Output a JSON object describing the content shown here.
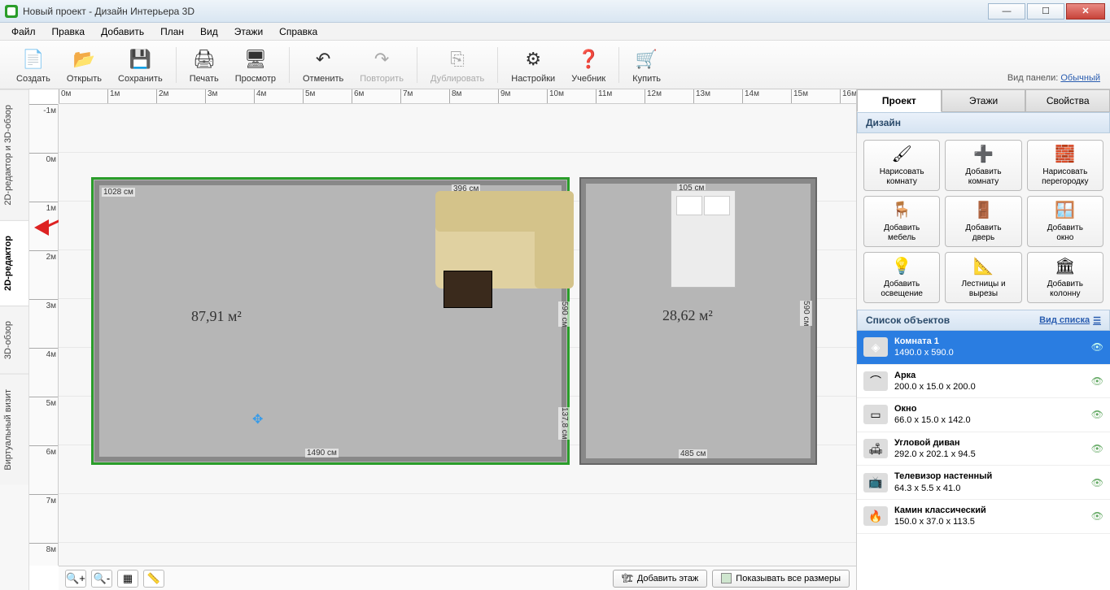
{
  "title": "Новый проект - Дизайн Интерьера 3D",
  "menu": [
    "Файл",
    "Правка",
    "Добавить",
    "План",
    "Вид",
    "Этажи",
    "Справка"
  ],
  "toolbar": [
    {
      "label": "Создать",
      "icon": "📄"
    },
    {
      "label": "Открыть",
      "icon": "📂"
    },
    {
      "label": "Сохранить",
      "icon": "💾"
    },
    {
      "sep": true
    },
    {
      "label": "Печать",
      "icon": "🖨"
    },
    {
      "label": "Просмотр",
      "icon": "🖥"
    },
    {
      "sep": true
    },
    {
      "label": "Отменить",
      "icon": "↶"
    },
    {
      "label": "Повторить",
      "icon": "↷",
      "disabled": true
    },
    {
      "sep": true
    },
    {
      "label": "Дублировать",
      "icon": "⎘",
      "disabled": true
    },
    {
      "sep": true
    },
    {
      "label": "Настройки",
      "icon": "⚙"
    },
    {
      "label": "Учебник",
      "icon": "❓"
    },
    {
      "sep": true
    },
    {
      "label": "Купить",
      "icon": "🛒"
    }
  ],
  "panel_label": "Вид панели:",
  "panel_mode": "Обычный",
  "vtabs": [
    "2D-редактор и 3D-обзор",
    "2D-редактор",
    "3D-обзор",
    "Виртуальный визит"
  ],
  "ruler_h": [
    "0м",
    "1м",
    "2м",
    "3м",
    "4м",
    "5м",
    "6м",
    "7м",
    "8м",
    "9м",
    "10м",
    "11м",
    "12м",
    "13м",
    "14м",
    "15м",
    "16м"
  ],
  "ruler_v": [
    "-1м",
    "0м",
    "1м",
    "2м",
    "3м",
    "4м",
    "5м",
    "6м",
    "7м",
    "8м"
  ],
  "room1": {
    "area": "87,91 м²",
    "w": "1490 см",
    "top": "1028 см",
    "door_h": "137,8 см",
    "door_w": "396 см",
    "side": "590 см"
  },
  "room2": {
    "area": "28,62 м²",
    "w": "485 см",
    "h": "590 см",
    "bed": "105 см"
  },
  "footer": {
    "add_floor": "Добавить этаж",
    "show_dims": "Показывать все размеры"
  },
  "rtabs": [
    "Проект",
    "Этажи",
    "Свойства"
  ],
  "design_header": "Дизайн",
  "design_buttons": [
    {
      "l1": "Нарисовать",
      "l2": "комнату",
      "icon": "🖌"
    },
    {
      "l1": "Добавить",
      "l2": "комнату",
      "icon": "➕"
    },
    {
      "l1": "Нарисовать",
      "l2": "перегородку",
      "icon": "🧱"
    },
    {
      "l1": "Добавить",
      "l2": "мебель",
      "icon": "🪑"
    },
    {
      "l1": "Добавить",
      "l2": "дверь",
      "icon": "🚪"
    },
    {
      "l1": "Добавить",
      "l2": "окно",
      "icon": "🪟"
    },
    {
      "l1": "Добавить",
      "l2": "освещение",
      "icon": "💡"
    },
    {
      "l1": "Лестницы и",
      "l2": "вырезы",
      "icon": "📐"
    },
    {
      "l1": "Добавить",
      "l2": "колонну",
      "icon": "🏛"
    }
  ],
  "objlist_header": "Список объектов",
  "listview": "Вид списка",
  "objects": [
    {
      "name": "Комната 1",
      "dims": "1490.0 x 590.0",
      "selected": true,
      "icon": "◈"
    },
    {
      "name": "Арка",
      "dims": "200.0 x 15.0 x 200.0",
      "icon": "⌒"
    },
    {
      "name": "Окно",
      "dims": "66.0 x 15.0 x 142.0",
      "icon": "▭"
    },
    {
      "name": "Угловой диван",
      "dims": "292.0 x 202.1 x 94.5",
      "icon": "🛋"
    },
    {
      "name": "Телевизор настенный",
      "dims": "64.3 x 5.5 x 41.0",
      "icon": "📺"
    },
    {
      "name": "Камин классический",
      "dims": "150.0 x 37.0 x 113.5",
      "icon": "🔥"
    }
  ]
}
